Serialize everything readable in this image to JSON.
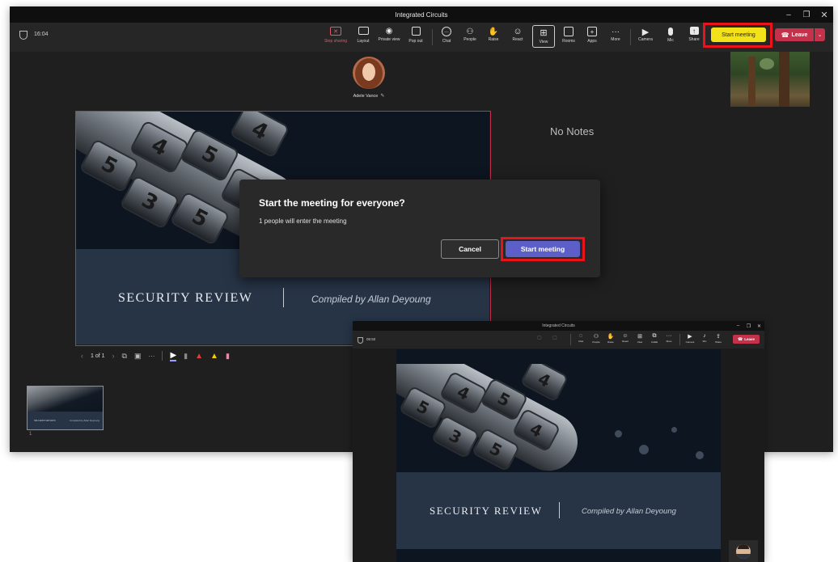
{
  "main_window": {
    "title": "Integrated Circuits",
    "timer": "16:04",
    "toolbar": {
      "stop_sharing": "Stop sharing",
      "layout": "Layout",
      "private_view": "Private view",
      "pop_out": "Pop out",
      "chat": "Chat",
      "people": "People",
      "raise": "Raise",
      "react": "React",
      "view": "View",
      "rooms": "Rooms",
      "apps": "Apps",
      "more": "More",
      "camera": "Camera",
      "mic": "Mic",
      "share": "Share",
      "start_meeting": "Start meeting",
      "leave": "Leave"
    },
    "participant_name": "Adele Vance",
    "notes_text": "No Notes",
    "slide": {
      "title": "SECURITY REVIEW",
      "subtitle": "Compiled by Allan Deyoung",
      "dial_digits": [
        "5",
        "4",
        "5",
        "4",
        "3",
        "5",
        "4"
      ]
    },
    "slide_nav": {
      "counter": "1 of 1",
      "more": "···"
    },
    "thumbnail": {
      "number": "1",
      "title": "SECURITY REVIEW",
      "subtitle": "Compiled by Allan Deyoung"
    },
    "dialog": {
      "title": "Start the meeting for everyone?",
      "message": "1 people will enter the meeting",
      "cancel": "Cancel",
      "confirm": "Start meeting"
    }
  },
  "attendee_window": {
    "title": "Integrated Circuits",
    "timer": "05:50",
    "toolbar": {
      "chat": "Chat",
      "people": "People",
      "raise": "Raise",
      "react": "React",
      "view": "View",
      "rooms": "CAEE",
      "more": "More",
      "camera": "Camera",
      "mic": "Mic",
      "share": "Share",
      "leave": "Leave"
    },
    "slide": {
      "title": "SECURITY REVIEW",
      "subtitle": "Compiled by Allan Deyoung"
    }
  },
  "colors": {
    "highlight_box": "#e8131b",
    "start_meeting_button": "#f3e21a",
    "leave_button": "#c4314b",
    "confirm_button": "#5b5fc7",
    "thumbnail_border": "#e07b29",
    "slide_border": "#c4314b",
    "slide_bottom": "#263446"
  }
}
